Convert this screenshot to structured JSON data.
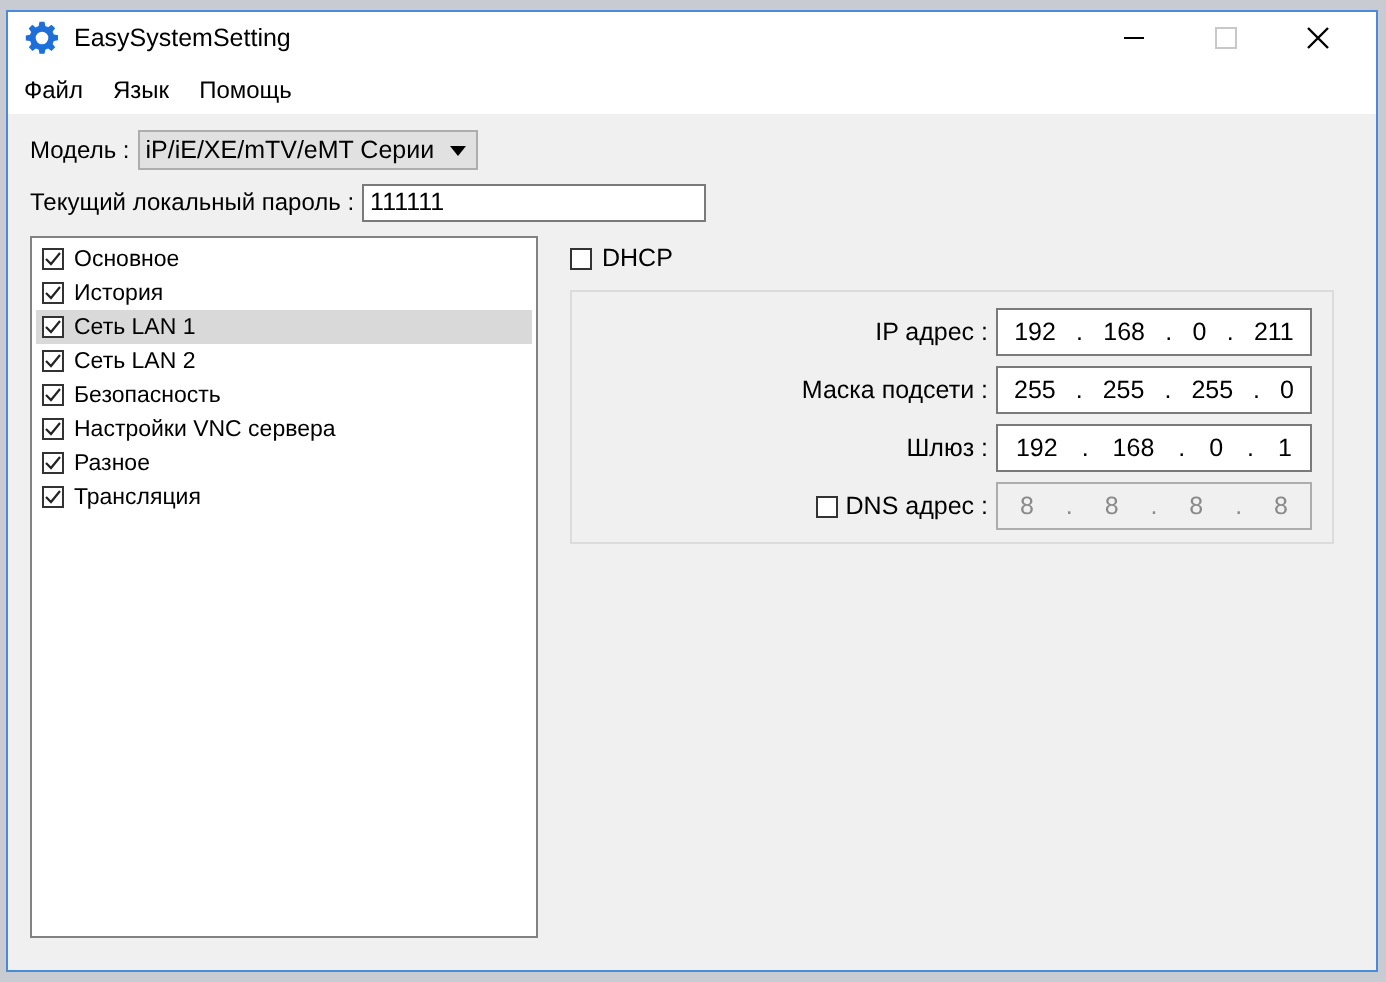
{
  "window": {
    "title": "EasySystemSetting"
  },
  "menu": [
    {
      "label": "Файл"
    },
    {
      "label": "Язык"
    },
    {
      "label": "Помощь"
    }
  ],
  "model": {
    "label": "Модель :",
    "value": "iP/iE/XE/mTV/eMT Серии"
  },
  "password": {
    "label": "Текущий локальный пароль :",
    "value": "111111"
  },
  "sections": [
    {
      "label": "Основное",
      "checked": true,
      "selected": false
    },
    {
      "label": "История",
      "checked": true,
      "selected": false
    },
    {
      "label": "Сеть LAN 1",
      "checked": true,
      "selected": true
    },
    {
      "label": "Сеть LAN 2",
      "checked": true,
      "selected": false
    },
    {
      "label": "Безопасность",
      "checked": true,
      "selected": false
    },
    {
      "label": "Настройки VNC сервера",
      "checked": true,
      "selected": false
    },
    {
      "label": "Разное",
      "checked": true,
      "selected": false
    },
    {
      "label": "Трансляция",
      "checked": true,
      "selected": false
    }
  ],
  "dhcp": {
    "label": "DHCP",
    "checked": false
  },
  "ip_separator": ".",
  "addresses": [
    {
      "kind": "plain",
      "label": "IP адрес :",
      "octets": [
        "192",
        "168",
        "0",
        "211"
      ],
      "disabled": false
    },
    {
      "kind": "plain",
      "label": "Маска подсети :",
      "octets": [
        "255",
        "255",
        "255",
        "0"
      ],
      "disabled": false
    },
    {
      "kind": "plain",
      "label": "Шлюз :",
      "octets": [
        "192",
        "168",
        "0",
        "1"
      ],
      "disabled": false
    },
    {
      "kind": "checkbox",
      "label": "DNS адрес :",
      "checked": false,
      "octets": [
        "8",
        "8",
        "8",
        "8"
      ],
      "disabled": true
    }
  ]
}
